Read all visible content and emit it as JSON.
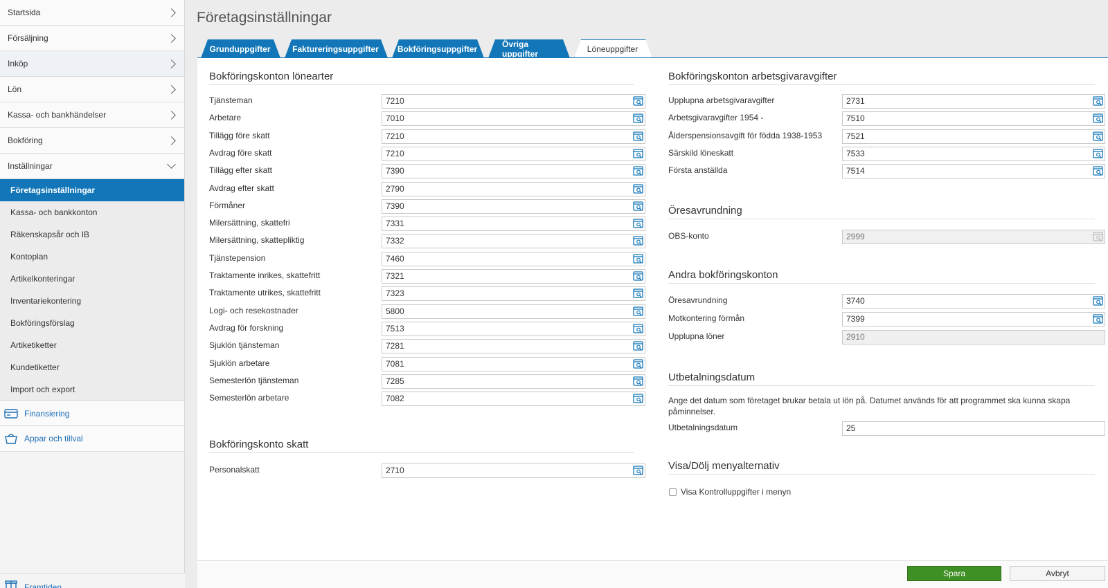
{
  "sidebar": {
    "nav": [
      {
        "label": "Startsida"
      },
      {
        "label": "Försäljning"
      },
      {
        "label": "Inköp"
      },
      {
        "label": "Lön"
      },
      {
        "label": "Kassa- och bankhändelser"
      },
      {
        "label": "Bokföring"
      },
      {
        "label": "Inställningar"
      }
    ],
    "sub": [
      {
        "label": "Företagsinställningar"
      },
      {
        "label": "Kassa- och bankkonton"
      },
      {
        "label": "Räkenskapsår och IB"
      },
      {
        "label": "Kontoplan"
      },
      {
        "label": "Artikelkonteringar"
      },
      {
        "label": "Inventariekontering"
      },
      {
        "label": "Bokföringsförslag"
      },
      {
        "label": "Artiketiketter"
      },
      {
        "label": "Kundetiketter"
      },
      {
        "label": "Import och export"
      }
    ],
    "extra": [
      {
        "label": "Finansiering",
        "icon": "credit-card-icon"
      },
      {
        "label": "Appar och tillval",
        "icon": "basket-icon"
      }
    ],
    "bottom": {
      "label": "Framtiden",
      "icon": "gift-icon"
    }
  },
  "page": {
    "title": "Företagsinställningar"
  },
  "tabs": [
    {
      "label": "Grunduppgifter"
    },
    {
      "label": "Faktureringsuppgifter"
    },
    {
      "label": "Bokföringsuppgifter"
    },
    {
      "label": "Övriga uppgifter"
    },
    {
      "label": "Löneuppgifter"
    }
  ],
  "left": {
    "section1": {
      "title": "Bokföringskonton lönearter",
      "rows": [
        {
          "label": "Tjänsteman",
          "value": "7210"
        },
        {
          "label": "Arbetare",
          "value": "7010"
        },
        {
          "label": "Tillägg före skatt",
          "value": "7210"
        },
        {
          "label": "Avdrag före skatt",
          "value": "7210"
        },
        {
          "label": "Tillägg efter skatt",
          "value": "7390"
        },
        {
          "label": "Avdrag efter skatt",
          "value": "2790"
        },
        {
          "label": "Förmåner",
          "value": "7390"
        },
        {
          "label": "Milersättning, skattefri",
          "value": "7331"
        },
        {
          "label": "Milersättning, skattepliktig",
          "value": "7332"
        },
        {
          "label": "Tjänstepension",
          "value": "7460"
        },
        {
          "label": "Traktamente inrikes, skattefritt",
          "value": "7321"
        },
        {
          "label": "Traktamente utrikes, skattefritt",
          "value": "7323"
        },
        {
          "label": "Logi- och resekostnader",
          "value": "5800"
        },
        {
          "label": "Avdrag för forskning",
          "value": "7513"
        },
        {
          "label": "Sjuklön tjänsteman",
          "value": "7281"
        },
        {
          "label": "Sjuklön arbetare",
          "value": "7081"
        },
        {
          "label": "Semesterlön tjänsteman",
          "value": "7285"
        },
        {
          "label": "Semesterlön arbetare",
          "value": "7082"
        }
      ]
    },
    "section2": {
      "title": "Bokföringskonto skatt",
      "rows": [
        {
          "label": "Personalskatt",
          "value": "2710"
        }
      ]
    }
  },
  "right": {
    "section1": {
      "title": "Bokföringskonton arbetsgivaravgifter",
      "rows": [
        {
          "label": "Upplupna arbetsgivaravgifter",
          "value": "2731"
        },
        {
          "label": "Arbetsgivaravgifter 1954 -",
          "value": "7510"
        },
        {
          "label": "Ålderspensionsavgift för födda 1938-1953",
          "value": "7521"
        },
        {
          "label": "Särskild löneskatt",
          "value": "7533"
        },
        {
          "label": "Första anställda",
          "value": "7514"
        }
      ]
    },
    "section2": {
      "title": "Öresavrundning",
      "rows": [
        {
          "label": "OBS-konto",
          "value": "2999"
        }
      ]
    },
    "section3": {
      "title": "Andra bokföringskonton",
      "rows": [
        {
          "label": "Öresavrundning",
          "value": "3740"
        },
        {
          "label": "Motkontering förmån",
          "value": "7399"
        },
        {
          "label": "Upplupna löner",
          "value": "2910"
        }
      ]
    },
    "section4": {
      "title": "Utbetalningsdatum",
      "description": "Ange det datum som företaget brukar betala ut lön på. Datumet används för att programmet ska kunna skapa påminnelser.",
      "label": "Utbetalningsdatum",
      "value": "25"
    },
    "section5": {
      "title": "Visa/Dölj menyalternativ",
      "checkbox_label": "Visa Kontrolluppgifter i menyn"
    }
  },
  "footer": {
    "save": "Spara",
    "cancel": "Avbryt"
  },
  "colors": {
    "accent": "#1276b8",
    "save": "#3e8f24"
  }
}
